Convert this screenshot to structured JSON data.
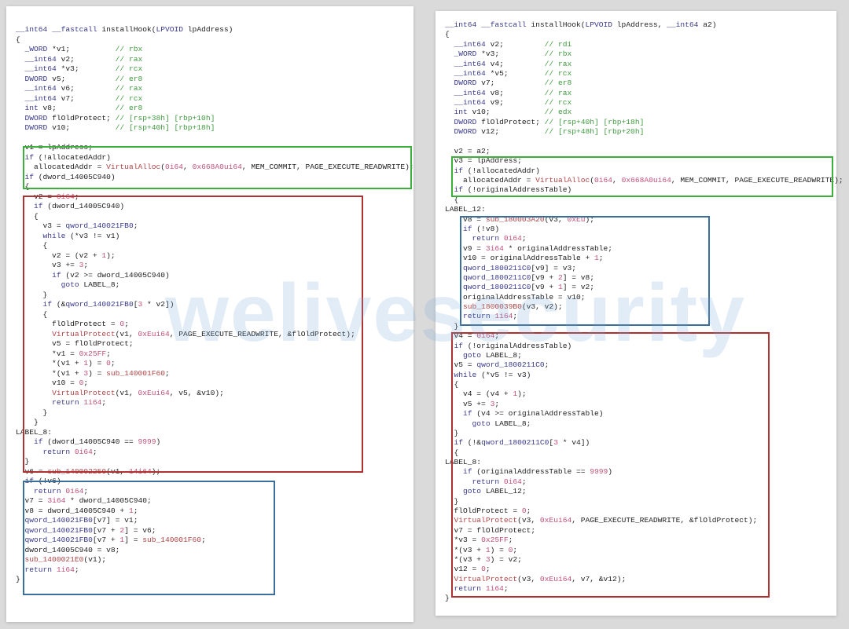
{
  "watermark": "welivesecurity",
  "left_code": [
    "__int64 __fastcall installHook(LPVOID lpAddress)",
    "{",
    "  _WORD *v1;          // rbx",
    "  __int64 v2;         // rax",
    "  __int64 *v3;        // rcx",
    "  DWORD v5;           // er8",
    "  __int64 v6;         // rax",
    "  __int64 v7;         // rcx",
    "  int v8;             // er8",
    "  DWORD flOldProtect; // [rsp+38h] [rbp+10h]",
    "  DWORD v10;          // [rsp+40h] [rbp+18h]",
    "",
    "  v1 = lpAddress;",
    "  if (!allocatedAddr)",
    "    allocatedAddr = VirtualAlloc(0i64, 0x668A0ui64, MEM_COMMIT, PAGE_EXECUTE_READWRITE);",
    "  if (dword_14005C940)",
    "  {",
    "    v2 = 0i64;",
    "    if (dword_14005C940)",
    "    {",
    "      v3 = qword_140021FB0;",
    "      while (*v3 != v1)",
    "      {",
    "        v2 = (v2 + 1);",
    "        v3 += 3;",
    "        if (v2 >= dword_14005C940)",
    "          goto LABEL_8;",
    "      }",
    "      if (&qword_140021FB0[3 * v2])",
    "      {",
    "        flOldProtect = 0;",
    "        VirtualProtect(v1, 0xEui64, PAGE_EXECUTE_READWRITE, &flOldProtect);",
    "        v5 = flOldProtect;",
    "        *v1 = 0x25FF;",
    "        *(v1 + 1) = 0;",
    "        *(v1 + 3) = sub_140001F60;",
    "        v10 = 0;",
    "        VirtualProtect(v1, 0xEui64, v5, &v10);",
    "        return 1i64;",
    "      }",
    "    }",
    "LABEL_8:",
    "    if (dword_14005C940 == 9999)",
    "      return 0i64;",
    "  }",
    "  v6 = sub_140002250(v1, 14i64);",
    "  if (!v6)",
    "    return 0i64;",
    "  v7 = 3i64 * dword_14005C940;",
    "  v8 = dword_14005C940 + 1;",
    "  qword_140021FB0[v7] = v1;",
    "  qword_140021FB0[v7 + 2] = v6;",
    "  qword_140021FB0[v7 + 1] = sub_140001F60;",
    "  dword_14005C940 = v8;",
    "  sub_1400021E0(v1);",
    "  return 1i64;",
    "}"
  ],
  "right_code": [
    "__int64 __fastcall installHook(LPVOID lpAddress, __int64 a2)",
    "{",
    "  __int64 v2;         // rdi",
    "  _WORD *v3;          // rbx",
    "  __int64 v4;         // rax",
    "  __int64 *v5;        // rcx",
    "  DWORD v7;           // er8",
    "  __int64 v8;         // rax",
    "  __int64 v9;         // rcx",
    "  int v10;            // edx",
    "  DWORD flOldProtect; // [rsp+40h] [rbp+18h]",
    "  DWORD v12;          // [rsp+48h] [rbp+20h]",
    "",
    "  v2 = a2;",
    "  v3 = lpAddress;",
    "  if (!allocatedAddr)",
    "    allocatedAddr = VirtualAlloc(0i64, 0x668A0ui64, MEM_COMMIT, PAGE_EXECUTE_READWRITE);",
    "  if (!originalAddressTable)",
    "  {",
    "LABEL_12:",
    "    v8 = sub_180003A20(v3, 0xEu);",
    "    if (!v8)",
    "      return 0i64;",
    "    v9 = 3i64 * originalAddressTable;",
    "    v10 = originalAddressTable + 1;",
    "    qword_1800211C0[v9] = v3;",
    "    qword_1800211C0[v9 + 2] = v8;",
    "    qword_1800211C0[v9 + 1] = v2;",
    "    originalAddressTable = v10;",
    "    sub_1800039B0(v3, v2);",
    "    return 1i64;",
    "  }",
    "  v4 = 0i64;",
    "  if (!originalAddressTable)",
    "    goto LABEL_8;",
    "  v5 = qword_1800211C0;",
    "  while (*v5 != v3)",
    "  {",
    "    v4 = (v4 + 1);",
    "    v5 += 3;",
    "    if (v4 >= originalAddressTable)",
    "      goto LABEL_8;",
    "  }",
    "  if (!&qword_1800211C0[3 * v4])",
    "  {",
    "LABEL_8:",
    "    if (originalAddressTable == 9999)",
    "      return 0i64;",
    "    goto LABEL_12;",
    "  }",
    "  flOldProtect = 0;",
    "  VirtualProtect(v3, 0xEui64, PAGE_EXECUTE_READWRITE, &flOldProtect);",
    "  v7 = flOldProtect;",
    "  *v3 = 0x25FF;",
    "  *(v3 + 1) = 0;",
    "  *(v3 + 3) = v2;",
    "  v12 = 0;",
    "  VirtualProtect(v3, 0xEui64, v7, &v12);",
    "  return 1i64;",
    "}"
  ]
}
